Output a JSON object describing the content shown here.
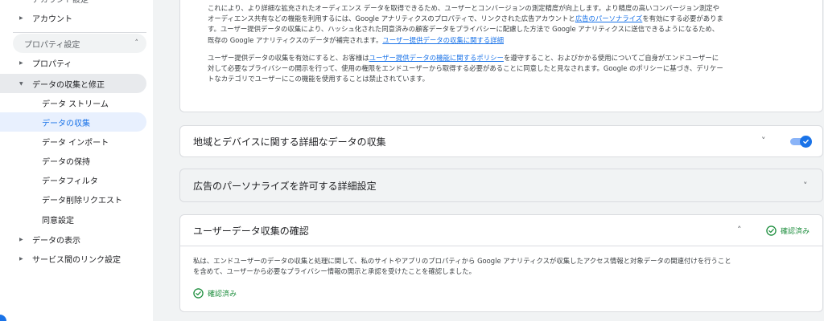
{
  "sidebar": {
    "top_cut_label": "アカウント設定",
    "account": "アカウント",
    "property_section": "プロパティ設定",
    "items": [
      {
        "label": "プロパティ"
      },
      {
        "label": "データの収集と修正"
      },
      {
        "label": "データ ストリーム"
      },
      {
        "label": "データの収集"
      },
      {
        "label": "データ インポート"
      },
      {
        "label": "データの保持"
      },
      {
        "label": "データフィルタ"
      },
      {
        "label": "データ削除リクエスト"
      },
      {
        "label": "同意設定"
      },
      {
        "label": "データの表示"
      },
      {
        "label": "サービス間のリンク設定"
      }
    ]
  },
  "card1": {
    "p1_a": "これにより、より詳細な拡充されたオーディエンス データを取得できるため、ユーザーとコンバージョンの測定精度が向上します。より精度の高いコンバージョン測定や",
    "p1_b": "オーディエンス共有などの機能を利用するには、Google アナリティクスのプロパティで、リンクされた広告アカウントと",
    "p1_link1": "広告のパーソナライズ",
    "p1_c": "を有効にする必要がありま",
    "p1_d": "す。ユーザー提供データの収集により、ハッシュ化された同意済みの顧客データをプライバシーに配慮した方法で Google アナリティクスに送信できるようになるため、",
    "p1_e": "既存の Google アナリティクスのデータが補完されます。",
    "p1_link2": "ユーザー提供データの収集に関する詳細",
    "p2_a": "ユーザー提供データの収集を有効にすると、お客様は",
    "p2_link": "ユーザー提供データの機能に関するポリシー",
    "p2_b": "を遵守すること、およびかかる使用についてご自身がエンドユーザーに",
    "p2_c": "対して必要なプライバシーの開示を行って、使用の権限をエンドユーザーから取得する必要があることに同意したと見なされます。Google のポリシーに基づき、デリケー",
    "p2_d": "トなカテゴリでユーザーにこの機能を使用することは禁止されています。"
  },
  "card2": {
    "title": "地域とデバイスに関する詳細なデータの収集",
    "toggle_on": true
  },
  "card3": {
    "title": "広告のパーソナライズを許可する詳細設定"
  },
  "card4": {
    "title": "ユーザーデータ収集の確認",
    "status": "確認済み",
    "body_a": "私は、エンドユーザーのデータの収集と処理に関して、私のサイトやアプリのプロパティから Google アナリティクスが収集したアクセス情報と対象データの関連付けを行うこと",
    "body_b": "を含めて、ユーザーから必要なプライバシー情報の開示と承認を受けたことを確認しました。",
    "footer_status": "確認済み"
  },
  "icons": {
    "expand": "chevron-down-icon",
    "collapse": "chevron-up-icon",
    "check": "check-circle-icon",
    "caret_right": "caret-right-icon",
    "caret_down": "caret-down-icon"
  },
  "colors": {
    "accent": "#1a73e8",
    "success": "#1e8e3e",
    "selected_bg": "#e8f0fe"
  }
}
